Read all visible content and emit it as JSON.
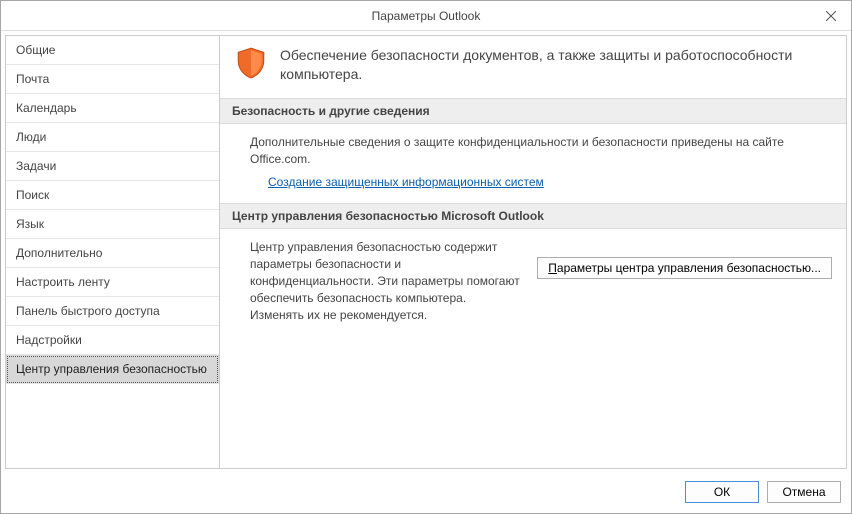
{
  "window": {
    "title": "Параметры Outlook"
  },
  "sidebar": {
    "items": [
      {
        "label": "Общие"
      },
      {
        "label": "Почта"
      },
      {
        "label": "Календарь"
      },
      {
        "label": "Люди"
      },
      {
        "label": "Задачи"
      },
      {
        "label": "Поиск"
      },
      {
        "label": "Язык"
      },
      {
        "label": "Дополнительно"
      },
      {
        "label": "Настроить ленту"
      },
      {
        "label": "Панель быстрого доступа"
      },
      {
        "label": "Надстройки"
      },
      {
        "label": "Центр управления безопасностью"
      }
    ],
    "selected_index": 11
  },
  "main": {
    "intro_text": "Обеспечение безопасности документов, а также защиты и работоспособности компьютера.",
    "section1": {
      "header": "Безопасность и другие сведения",
      "desc": "Дополнительные сведения о защите конфиденциальности и безопасности приведены на сайте Office.com.",
      "link": "Создание защищенных информационных систем"
    },
    "section2": {
      "header": "Центр управления безопасностью Microsoft Outlook",
      "desc": "Центр управления безопасностью содержит параметры безопасности и конфиденциальности. Эти параметры помогают обеспечить безопасность компьютера. Изменять их не рекомендуется.",
      "button_prefix": "П",
      "button_rest": "араметры центра управления безопасностью..."
    }
  },
  "footer": {
    "ok": "ОК",
    "cancel": "Отмена"
  }
}
